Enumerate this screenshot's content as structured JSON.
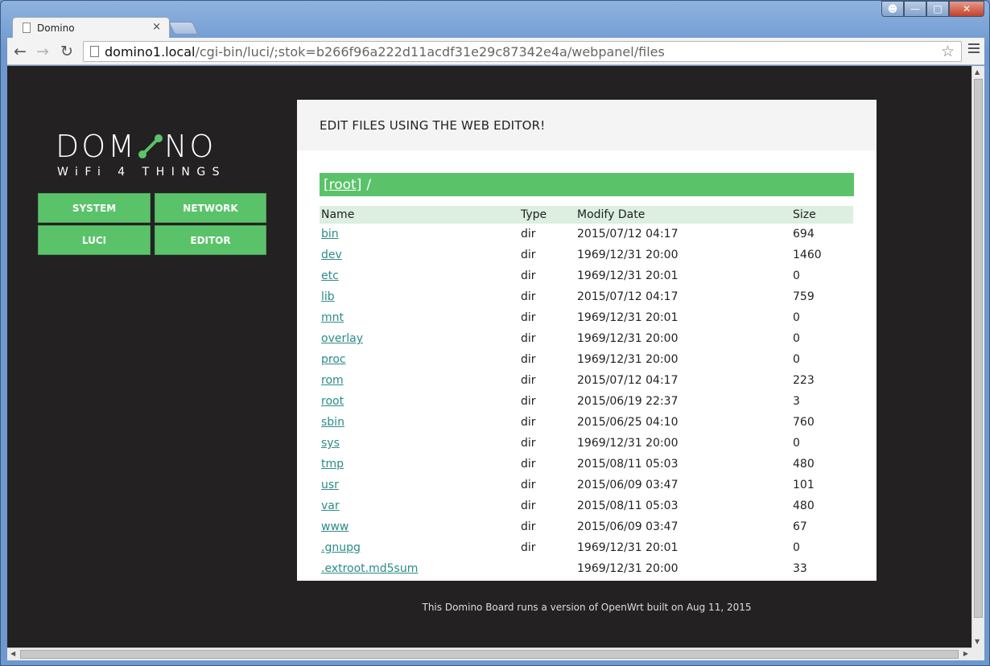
{
  "browser": {
    "tab_title": "Domino",
    "tab_close": "×",
    "url_host": "domino1.local",
    "url_path": "/cgi-bin/luci/;stok=b266f96a222d11acdf31e29c87342e4a/webpanel/files"
  },
  "logo": {
    "title_pre": "DOM",
    "title_post": "NO",
    "subtitle": "WiFi 4 THINGS",
    "accent_color": "#5ac36a"
  },
  "nav": {
    "system": "SYSTEM",
    "network": "NETWORK",
    "luci": "LUCI",
    "editor": "EDITOR"
  },
  "panel": {
    "header": "EDIT FILES USING THE WEB EDITOR!",
    "path_link": "[root]",
    "path_rest": "/"
  },
  "table": {
    "headers": [
      "Name",
      "Type",
      "Modify Date",
      "Size"
    ],
    "rows": [
      {
        "name": "bin",
        "type": "dir",
        "date": "2015/07/12 04:17",
        "size": "694"
      },
      {
        "name": "dev",
        "type": "dir",
        "date": "1969/12/31 20:00",
        "size": "1460"
      },
      {
        "name": "etc",
        "type": "dir",
        "date": "1969/12/31 20:01",
        "size": "0"
      },
      {
        "name": "lib",
        "type": "dir",
        "date": "2015/07/12 04:17",
        "size": "759"
      },
      {
        "name": "mnt",
        "type": "dir",
        "date": "1969/12/31 20:01",
        "size": "0"
      },
      {
        "name": "overlay",
        "type": "dir",
        "date": "1969/12/31 20:00",
        "size": "0"
      },
      {
        "name": "proc",
        "type": "dir",
        "date": "1969/12/31 20:00",
        "size": "0"
      },
      {
        "name": "rom",
        "type": "dir",
        "date": "2015/07/12 04:17",
        "size": "223"
      },
      {
        "name": "root",
        "type": "dir",
        "date": "2015/06/19 22:37",
        "size": "3"
      },
      {
        "name": "sbin",
        "type": "dir",
        "date": "2015/06/25 04:10",
        "size": "760"
      },
      {
        "name": "sys",
        "type": "dir",
        "date": "1969/12/31 20:00",
        "size": "0"
      },
      {
        "name": "tmp",
        "type": "dir",
        "date": "2015/08/11 05:03",
        "size": "480"
      },
      {
        "name": "usr",
        "type": "dir",
        "date": "2015/06/09 03:47",
        "size": "101"
      },
      {
        "name": "var",
        "type": "dir",
        "date": "2015/08/11 05:03",
        "size": "480"
      },
      {
        "name": "www",
        "type": "dir",
        "date": "2015/06/09 03:47",
        "size": "67"
      },
      {
        "name": ".gnupg",
        "type": "dir",
        "date": "1969/12/31 20:01",
        "size": "0"
      },
      {
        "name": ".extroot.md5sum",
        "type": "",
        "date": "1969/12/31 20:00",
        "size": "33"
      }
    ]
  },
  "footer": "This Domino Board runs a version of OpenWrt built on Aug 11, 2015"
}
